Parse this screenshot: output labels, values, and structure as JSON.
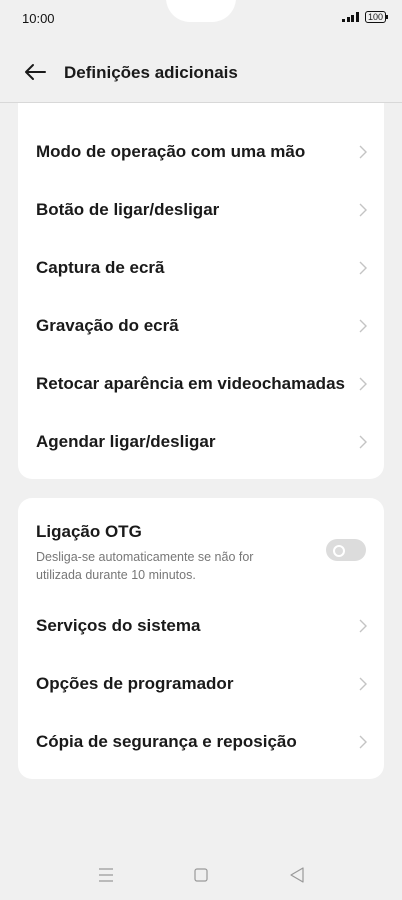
{
  "status": {
    "time": "10:00",
    "battery": "100"
  },
  "header": {
    "title": "Definições adicionais"
  },
  "group1": [
    {
      "label": "Modo de operação com uma mão"
    },
    {
      "label": "Botão de ligar/desligar"
    },
    {
      "label": "Captura de ecrã"
    },
    {
      "label": "Gravação do ecrã"
    },
    {
      "label": "Retocar aparência em videochamadas"
    },
    {
      "label": "Agendar ligar/desligar"
    }
  ],
  "otg": {
    "title": "Ligação OTG",
    "description": "Desliga-se automaticamente se não for utilizada durante 10 minutos.",
    "enabled": false
  },
  "group2": [
    {
      "label": "Serviços do sistema"
    },
    {
      "label": "Opções de programador"
    },
    {
      "label": "Cópia de segurança e reposição"
    }
  ],
  "icons": {
    "back": "arrow-left-icon",
    "chevron": "chevron-right-icon",
    "nav": [
      "menu-icon",
      "home-square-icon",
      "back-triangle-icon"
    ]
  },
  "colors": {
    "background": "#f0f0f0",
    "card": "#ffffff",
    "toggle_off": "#dcdcdc"
  }
}
